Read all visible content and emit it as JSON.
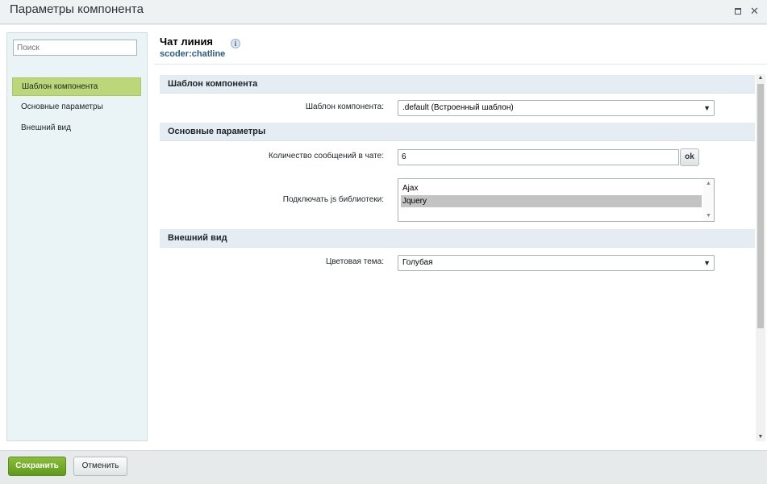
{
  "window": {
    "title": "Параметры компонента",
    "maximize_icon": "maximize-icon",
    "close_icon": "close-icon",
    "close_glyph": "✕"
  },
  "sidebar": {
    "search_placeholder": "Поиск",
    "items": [
      {
        "label": "Шаблон компонента",
        "active": true
      },
      {
        "label": "Основные параметры",
        "active": false
      },
      {
        "label": "Внешний вид",
        "active": false
      }
    ]
  },
  "component": {
    "name": "Чат линия",
    "code": "scoder:chatline",
    "info_glyph": "i"
  },
  "sections": {
    "template": {
      "title": "Шаблон компонента",
      "template_label": "Шаблон компонента:",
      "template_value": ".default (Встроенный шаблон)"
    },
    "main": {
      "title": "Основные параметры",
      "count_label": "Количество сообщений в чате:",
      "count_value": "6",
      "ok_label": "ok",
      "libs_label": "Подключать js библиотеки:",
      "libs_options": [
        {
          "label": "Ajax",
          "selected": false
        },
        {
          "label": "Jquery",
          "selected": true
        }
      ]
    },
    "appearance": {
      "title": "Внешний вид",
      "theme_label": "Цветовая тема:",
      "theme_value": "Голубая"
    }
  },
  "glyphs": {
    "dropdown_arrow": "▼",
    "scroll_up": "▲",
    "scroll_down": "▼"
  },
  "footer": {
    "save_label": "Сохранить",
    "cancel_label": "Отменить"
  },
  "colors": {
    "accent_active_nav": "#bcd77a",
    "save_button": "#6fa529",
    "section_header": "#e5ecf4",
    "component_code": "#2a5b8a"
  }
}
